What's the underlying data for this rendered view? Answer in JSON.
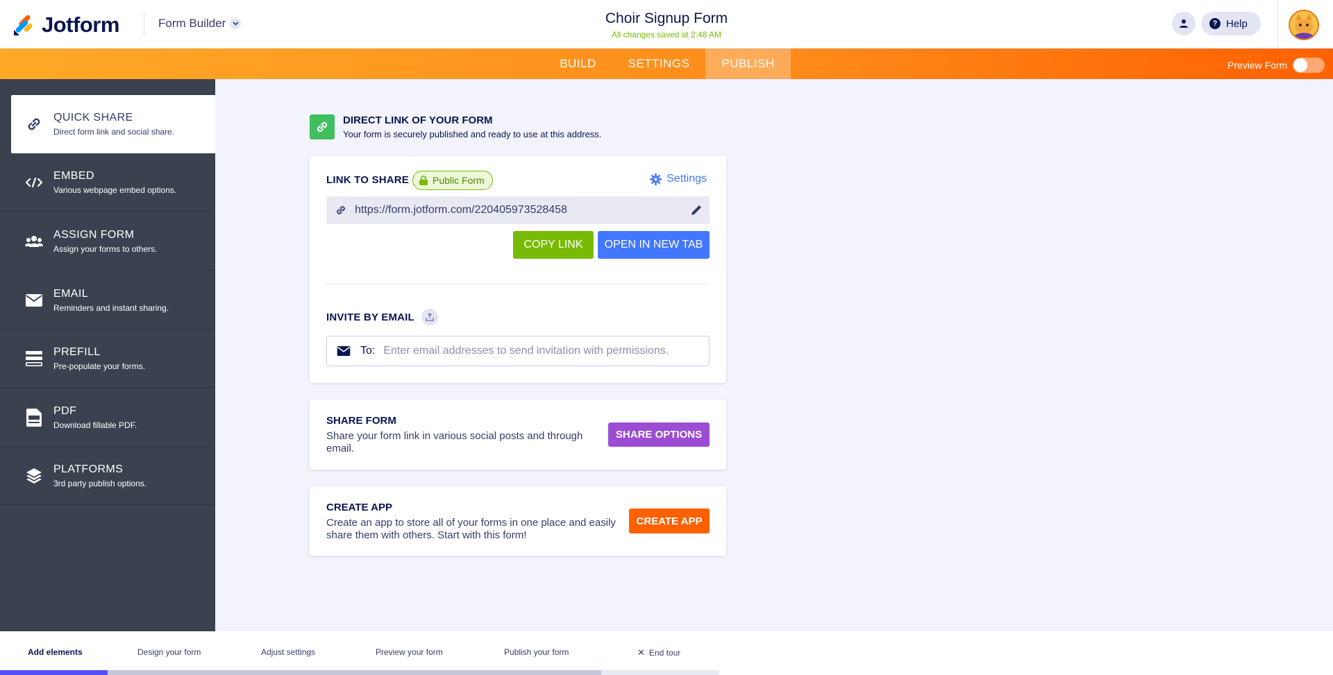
{
  "header": {
    "logo_text": "Jotform",
    "form_builder_label": "Form Builder",
    "form_title": "Choir Signup Form",
    "saved_status": "All changes saved at 2:48 AM",
    "help_label": "Help"
  },
  "nav": {
    "tabs": [
      "BUILD",
      "SETTINGS",
      "PUBLISH"
    ],
    "active_tab": "PUBLISH",
    "preview_label": "Preview Form",
    "preview_enabled": false
  },
  "sidebar": {
    "items": [
      {
        "title": "QUICK SHARE",
        "desc": "Direct form link and social share.",
        "icon": "link-icon",
        "active": true
      },
      {
        "title": "EMBED",
        "desc": "Various webpage embed options.",
        "icon": "code-icon",
        "active": false
      },
      {
        "title": "ASSIGN FORM",
        "desc": "Assign your forms to others.",
        "icon": "users-icon",
        "active": false
      },
      {
        "title": "EMAIL",
        "desc": "Reminders and instant sharing.",
        "icon": "envelope-icon",
        "active": false
      },
      {
        "title": "PREFILL",
        "desc": "Pre-populate your forms.",
        "icon": "prefill-icon",
        "active": false
      },
      {
        "title": "PDF",
        "desc": "Download fillable PDF.",
        "icon": "pdf-icon",
        "active": false
      },
      {
        "title": "PLATFORMS",
        "desc": "3rd party publish options.",
        "icon": "layers-icon",
        "active": false
      }
    ]
  },
  "direct_link": {
    "title": "DIRECT LINK OF YOUR FORM",
    "subtitle": "Your form is securely published and ready to use at this address."
  },
  "link_card": {
    "label": "LINK TO SHARE",
    "badge": "Public Form",
    "settings_label": "Settings",
    "url": "https://form.jotform.com/220405973528458",
    "copy_label": "COPY LINK",
    "open_label": "OPEN IN NEW TAB",
    "invite_label": "INVITE BY EMAIL",
    "to_label": "To:",
    "email_placeholder": "Enter email addresses to send invitation with permissions."
  },
  "share_card": {
    "title": "SHARE FORM",
    "desc": "Share your form link in various social posts and through email.",
    "button": "SHARE OPTIONS"
  },
  "app_card": {
    "title": "CREATE APP",
    "desc": "Create an app to store all of your forms in one place and easily share them with others. Start with this form!",
    "button": "CREATE APP"
  },
  "tour": {
    "steps": [
      "Add elements",
      "Design your form",
      "Adjust settings",
      "Preview your form",
      "Publish your form"
    ],
    "active_step": "Add elements",
    "end_label": "End tour",
    "progress_fraction": 0.15
  },
  "colors": {
    "orange_accent": "#ff6100",
    "green_button": "#78bb07",
    "blue_button": "#4277ff",
    "purple_button": "#9c4dd3",
    "sidebar_bg": "#3b424f"
  }
}
